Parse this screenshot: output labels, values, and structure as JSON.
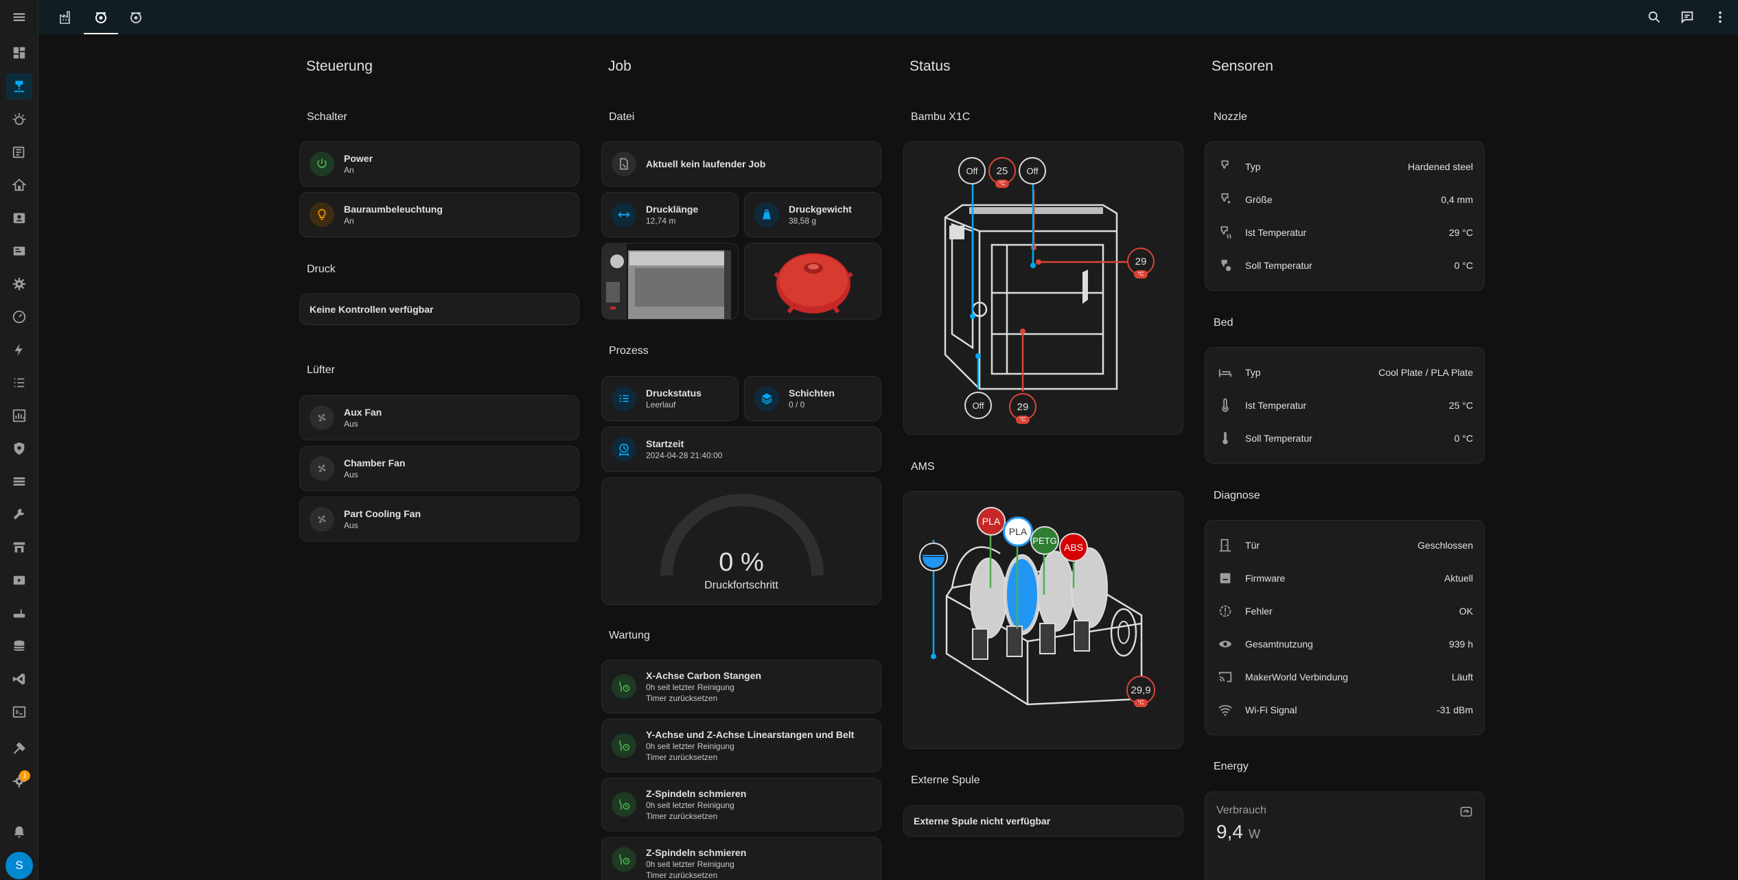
{
  "nav": {
    "sidebar_icons": [
      "dashboard-icon",
      "printer-icon",
      "robot-vacuum-icon",
      "news-icon",
      "home-icon",
      "badge-icon",
      "server-icon",
      "cog-icon",
      "gauge-icon",
      "lightning-icon",
      "list-icon",
      "chart-icon",
      "shield-icon",
      "layers-icon",
      "wrench-icon",
      "store-icon",
      "media-icon",
      "router-icon",
      "database-icon",
      "vscode-icon",
      "terminal-icon",
      "hammer-icon",
      "settings-icon"
    ],
    "settings_badge": "1",
    "avatar_letter": "S"
  },
  "columns": {
    "steuerung": "Steuerung",
    "job": "Job",
    "status": "Status",
    "sensoren": "Sensoren"
  },
  "steuerung": {
    "schalter_title": "Schalter",
    "power": {
      "name": "Power",
      "state": "An"
    },
    "light": {
      "name": "Bauraumbeleuchtung",
      "state": "An"
    },
    "druck_title": "Druck",
    "no_controls": "Keine Kontrollen verfügbar",
    "luefter_title": "Lüfter",
    "fans": [
      {
        "name": "Aux Fan",
        "state": "Aus"
      },
      {
        "name": "Chamber Fan",
        "state": "Aus"
      },
      {
        "name": "Part Cooling Fan",
        "state": "Aus"
      }
    ]
  },
  "job": {
    "datei_title": "Datei",
    "no_job": "Aktuell kein laufender Job",
    "length": {
      "name": "Drucklänge",
      "value": "12,74 m"
    },
    "weight": {
      "name": "Druckgewicht",
      "value": "38,58 g"
    },
    "prozess_title": "Prozess",
    "druckstatus": {
      "name": "Druckstatus",
      "value": "Leerlauf"
    },
    "schichten": {
      "name": "Schichten",
      "value": "0 / 0"
    },
    "startzeit": {
      "name": "Startzeit",
      "value": "2024-04-28 21:40:00"
    },
    "gauge": {
      "value": "0 %",
      "label": "Druckfortschritt",
      "fraction": 0
    },
    "wartung_title": "Wartung",
    "maintenance": [
      {
        "name": "X-Achse Carbon Stangen",
        "line1": "0h seit letzter Reinigung",
        "line2": "Timer zurücksetzen"
      },
      {
        "name": "Y-Achse und Z-Achse Linearstangen und Belt",
        "line1": "0h seit letzter Reinigung",
        "line2": "Timer zurücksetzen"
      },
      {
        "name": "Z-Spindeln schmieren",
        "line1": "0h seit letzter Reinigung",
        "line2": "Timer zurücksetzen"
      },
      {
        "name": "Z-Spindeln schmieren",
        "line1": "0h seit letzter Reinigung",
        "line2": "Timer zurücksetzen"
      }
    ]
  },
  "status": {
    "printer_title": "Bambu X1C",
    "printer_labels": {
      "top_left": "Off",
      "nozzle_temp": "25",
      "top_right": "Off",
      "chamber_temp": "29",
      "bottom_left": "Off",
      "bed_temp": "29",
      "unit": "°C"
    },
    "ams_title": "AMS",
    "ams": {
      "slots": [
        {
          "label": "PLA",
          "color": "#c62828"
        },
        {
          "label": "PLA",
          "color": "#ffffff"
        },
        {
          "label": "PETG",
          "color": "#2e7d32"
        },
        {
          "label": "ABS",
          "color": "#d50000"
        }
      ],
      "humidity": "29,9",
      "unit": "°C"
    },
    "ext_title": "Externe Spule",
    "ext_none": "Externe Spule nicht verfügbar"
  },
  "sensoren": {
    "nozzle_title": "Nozzle",
    "nozzle": [
      {
        "label": "Typ",
        "value": "Hardened steel"
      },
      {
        "label": "Größe",
        "value": "0,4 mm"
      },
      {
        "label": "Ist Temperatur",
        "value": "29 °C"
      },
      {
        "label": "Soll Temperatur",
        "value": "0 °C"
      }
    ],
    "bed_title": "Bed",
    "bed": [
      {
        "label": "Typ",
        "value": "Cool Plate / PLA Plate"
      },
      {
        "label": "Ist Temperatur",
        "value": "25 °C"
      },
      {
        "label": "Soll Temperatur",
        "value": "0 °C"
      }
    ],
    "diag_title": "Diagnose",
    "diag": [
      {
        "label": "Tür",
        "value": "Geschlossen"
      },
      {
        "label": "Firmware",
        "value": "Aktuell"
      },
      {
        "label": "Fehler",
        "value": "OK"
      },
      {
        "label": "Gesamtnutzung",
        "value": "939 h"
      },
      {
        "label": "MakerWorld Verbindung",
        "value": "Läuft"
      },
      {
        "label": "Wi-Fi Signal",
        "value": "-31 dBm"
      }
    ],
    "energy_title": "Energy",
    "verbrauch": "Verbrauch",
    "power_value": "9,4",
    "power_unit": "W"
  },
  "colors": {
    "accent": "#03a9f4",
    "green": "#4caf50",
    "amber": "#ff9800",
    "red": "#db4437"
  }
}
